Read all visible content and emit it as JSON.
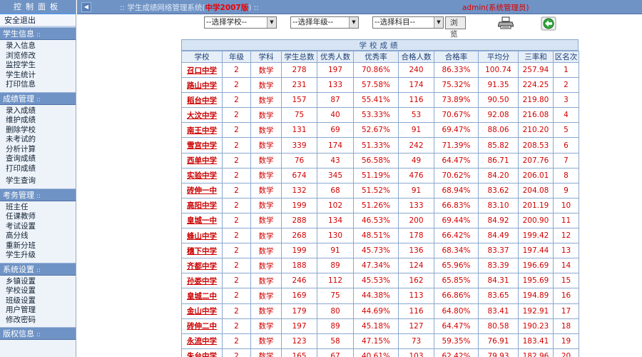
{
  "sidebar": {
    "title": "控制面板",
    "exit": "安全退出",
    "sections": [
      {
        "title": "学生信息",
        "items": [
          "录入信息",
          "浏览修改",
          "监控学生",
          "学生统计",
          "打印信息"
        ]
      },
      {
        "title": "成绩管理",
        "items": [
          "录入成绩",
          "维护成绩",
          "删除学校",
          "未考试的",
          "分析计算",
          "查询成绩",
          "打印成绩",
          "学生查询"
        ]
      },
      {
        "title": "考务管理",
        "items": [
          "班主任",
          "任课教师",
          "考试设置",
          "高分线",
          "重新分班",
          "学生升级"
        ]
      },
      {
        "title": "系统设置",
        "items": [
          "乡镇设置",
          "学校设置",
          "班级设置",
          "用户管理",
          "修改密码"
        ]
      },
      {
        "title": "版权信息",
        "items": []
      }
    ]
  },
  "topbar": {
    "title_prefix": ":: 学生成绩网络管理系统(",
    "title_highlight": "中学2007版",
    "title_suffix": ") ::",
    "admin": "admin(系统管理员)"
  },
  "filters": {
    "school": "--选择学校--",
    "grade": "--选择年级--",
    "subject": "--选择科目--",
    "browse_label": "浏览"
  },
  "results": {
    "caption": "学校成绩",
    "headers": [
      "学校",
      "年级",
      "学科",
      "学生总数",
      "优秀人数",
      "优秀率",
      "合格人数",
      "合格率",
      "平均分",
      "三率和",
      "区名次"
    ],
    "rows": [
      [
        "召口中学",
        "2",
        "数学",
        "278",
        "197",
        "70.86%",
        "240",
        "86.33%",
        "100.74",
        "257.94",
        "1"
      ],
      [
        "路山中学",
        "2",
        "数学",
        "231",
        "133",
        "57.58%",
        "174",
        "75.32%",
        "91.35",
        "224.25",
        "2"
      ],
      [
        "稻台中学",
        "2",
        "数学",
        "157",
        "87",
        "55.41%",
        "116",
        "73.89%",
        "90.50",
        "219.80",
        "3"
      ],
      [
        "大汶中学",
        "2",
        "数学",
        "75",
        "40",
        "53.33%",
        "53",
        "70.67%",
        "92.08",
        "216.08",
        "4"
      ],
      [
        "南王中学",
        "2",
        "数学",
        "131",
        "69",
        "52.67%",
        "91",
        "69.47%",
        "88.06",
        "210.20",
        "5"
      ],
      [
        "雪宫中学",
        "2",
        "数学",
        "339",
        "174",
        "51.33%",
        "242",
        "71.39%",
        "85.82",
        "208.53",
        "6"
      ],
      [
        "西单中学",
        "2",
        "数学",
        "76",
        "43",
        "56.58%",
        "49",
        "64.47%",
        "86.71",
        "207.76",
        "7"
      ],
      [
        "实验中学",
        "2",
        "数学",
        "674",
        "345",
        "51.19%",
        "476",
        "70.62%",
        "84.20",
        "206.01",
        "8"
      ],
      [
        "砖伸一中",
        "2",
        "数学",
        "132",
        "68",
        "51.52%",
        "91",
        "68.94%",
        "83.62",
        "204.08",
        "9"
      ],
      [
        "高阳中学",
        "2",
        "数学",
        "199",
        "102",
        "51.26%",
        "133",
        "66.83%",
        "83.10",
        "201.19",
        "10"
      ],
      [
        "皇城一中",
        "2",
        "数学",
        "288",
        "134",
        "46.53%",
        "200",
        "69.44%",
        "84.92",
        "200.90",
        "11"
      ],
      [
        "蜂山中学",
        "2",
        "数学",
        "268",
        "130",
        "48.51%",
        "178",
        "66.42%",
        "84.49",
        "199.42",
        "12"
      ],
      [
        "穗下中学",
        "2",
        "数学",
        "199",
        "91",
        "45.73%",
        "136",
        "68.34%",
        "83.37",
        "197.44",
        "13"
      ],
      [
        "齐都中学",
        "2",
        "数学",
        "188",
        "89",
        "47.34%",
        "124",
        "65.96%",
        "83.39",
        "196.69",
        "14"
      ],
      [
        "孙娄中学",
        "2",
        "数学",
        "246",
        "112",
        "45.53%",
        "162",
        "65.85%",
        "84.31",
        "195.69",
        "15"
      ],
      [
        "皇城二中",
        "2",
        "数学",
        "169",
        "75",
        "44.38%",
        "113",
        "66.86%",
        "83.65",
        "194.89",
        "16"
      ],
      [
        "金山中学",
        "2",
        "数学",
        "179",
        "80",
        "44.69%",
        "116",
        "64.80%",
        "83.41",
        "192.91",
        "17"
      ],
      [
        "砖伸二中",
        "2",
        "数学",
        "197",
        "89",
        "45.18%",
        "127",
        "64.47%",
        "80.58",
        "190.23",
        "18"
      ],
      [
        "永流中学",
        "2",
        "数学",
        "123",
        "58",
        "47.15%",
        "73",
        "59.35%",
        "76.91",
        "183.41",
        "19"
      ],
      [
        "朱台中学",
        "2",
        "数学",
        "165",
        "67",
        "40.61%",
        "103",
        "62.42%",
        "79.93",
        "182.96",
        "20"
      ]
    ]
  }
}
